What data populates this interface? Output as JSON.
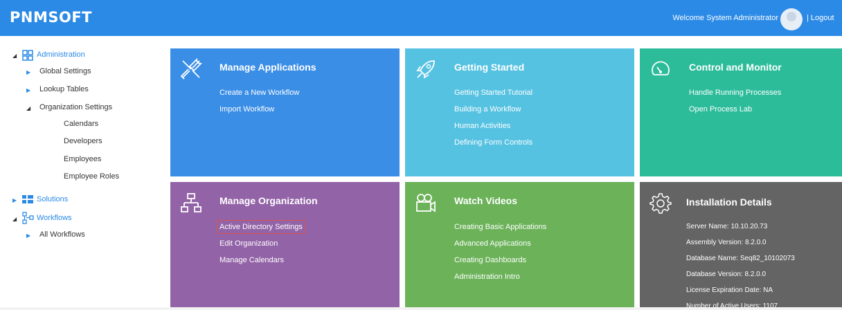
{
  "header": {
    "logo_text": "PNMSOFT",
    "welcome_text": "Welcome System Administrator",
    "logout_label": "| Logout"
  },
  "sidebar": {
    "administration": "Administration",
    "global_settings": "Global Settings",
    "lookup_tables": "Lookup Tables",
    "organization_settings": "Organization Settings",
    "calendars": "Calendars",
    "developers": "Developers",
    "employees": "Employees",
    "employee_roles": "Employee Roles",
    "solutions": "Solutions",
    "workflows": "Workflows",
    "all_workflows": "All Workflows"
  },
  "tiles": {
    "manage_applications": {
      "title": "Manage Applications",
      "links": [
        "Create a New Workflow",
        "Import Workflow"
      ],
      "color": "#3a8ee6",
      "icon": "tools-icon"
    },
    "getting_started": {
      "title": "Getting Started",
      "links": [
        "Getting Started Tutorial",
        "Building a Workflow",
        "Human Activities",
        "Defining Form Controls"
      ],
      "color": "#56c2e2",
      "icon": "rocket-icon"
    },
    "control_monitor": {
      "title": "Control and Monitor",
      "links": [
        "Handle Running Processes",
        "Open Process Lab"
      ],
      "color": "#2dbc9a",
      "icon": "gauge-icon"
    },
    "manage_organization": {
      "title": "Manage Organization",
      "links": [
        "Active Directory Settings",
        "Edit Organization",
        "Manage Calendars"
      ],
      "color": "#9363a7",
      "icon": "org-chart-icon"
    },
    "watch_videos": {
      "title": "Watch Videos",
      "links": [
        "Creating Basic Applications",
        "Advanced Applications",
        "Creating Dashboards",
        "Administration Intro"
      ],
      "color": "#6bb259",
      "icon": "video-camera-icon"
    },
    "installation_details": {
      "title": "Installation Details",
      "details": [
        "Server Name: 10.10.20.73",
        "Assembly Version: 8.2.0.0",
        "Database Name: Seq82_10102073",
        "Database Version: 8.2.0.0",
        "License Expiration Date: NA",
        "Number of Active Users: 1107"
      ],
      "color": "#646464",
      "icon": "gear-icon"
    }
  }
}
